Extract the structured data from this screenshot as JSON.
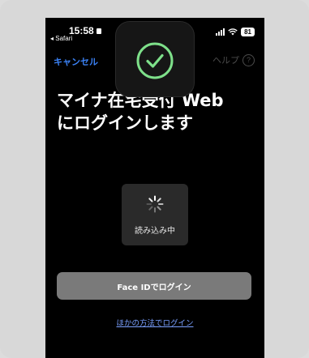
{
  "status_bar": {
    "time": "15:58",
    "back_app": "◂ Safari",
    "battery": "81"
  },
  "nav": {
    "cancel_label": "キャンセル",
    "help_label": "ヘルプ",
    "help_icon": "?"
  },
  "main": {
    "title_line1": "マイナ在宅受付 Web",
    "title_line2": "にログインします",
    "loading_label": "読み込み中",
    "faceid_button": "Face IDでログイン",
    "other_method_link": "ほかの方法でログイン"
  },
  "colors": {
    "accent": "#3b82f6",
    "check": "#7ee08a"
  }
}
